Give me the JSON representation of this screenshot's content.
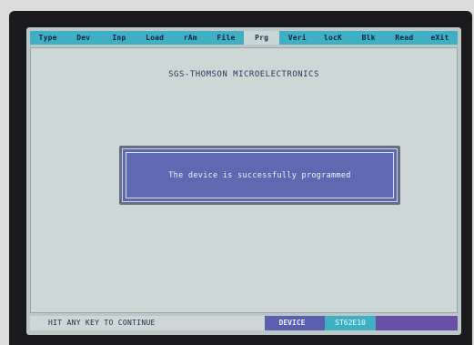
{
  "menu": {
    "items": [
      {
        "label": "Type",
        "active": false
      },
      {
        "label": "Dev",
        "active": false
      },
      {
        "label": "Inp",
        "active": false
      },
      {
        "label": "Load",
        "active": false
      },
      {
        "label": "rAm",
        "active": false
      },
      {
        "label": "File",
        "active": false
      },
      {
        "label": "Prg",
        "active": true
      },
      {
        "label": "Veri",
        "active": false
      },
      {
        "label": "locK",
        "active": false
      },
      {
        "label": "Blk",
        "active": false
      },
      {
        "label": "Read",
        "active": false
      },
      {
        "label": "eXit",
        "active": false
      }
    ]
  },
  "main": {
    "title": "SGS-THOMSON MICROELECTRONICS"
  },
  "dialog": {
    "message": "The device is successfully programmed"
  },
  "status": {
    "message": "HIT ANY KEY TO CONTINUE",
    "device_label": "DEVICE",
    "device_value": "ST62E10"
  },
  "colors": {
    "menubar": "#3fb0c4",
    "dialog": "#5d6ab2",
    "screen": "#cdd7d6",
    "bezel": "#1b1a1d"
  }
}
